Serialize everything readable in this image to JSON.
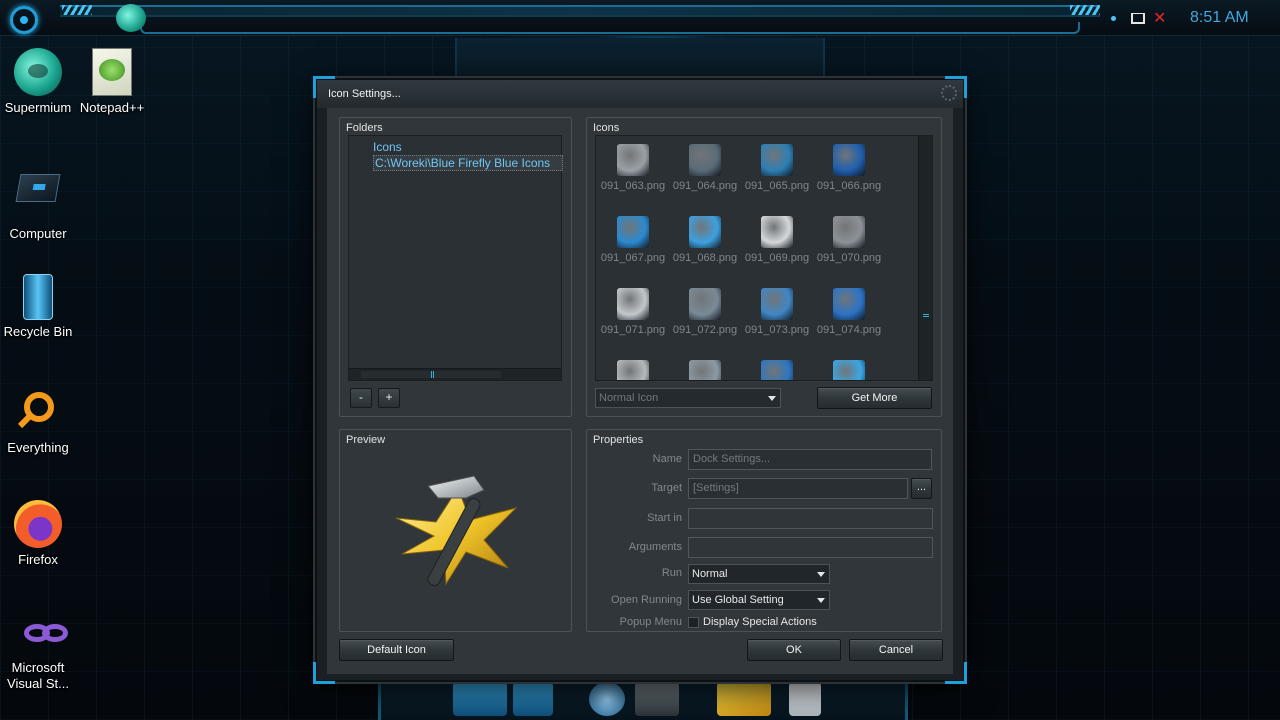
{
  "taskbar": {
    "clock": "8:51 AM"
  },
  "desktop_icons": [
    {
      "label": "Supermium",
      "icon": "supermium-icon"
    },
    {
      "label": "Notepad++",
      "icon": "notepad-plus-plus-icon"
    },
    {
      "label": "Computer",
      "icon": "computer-icon"
    },
    {
      "label": "Recycle Bin",
      "icon": "recycle-bin-icon"
    },
    {
      "label": "Everything",
      "icon": "everything-search-icon"
    },
    {
      "label": "Firefox",
      "icon": "firefox-icon"
    },
    {
      "label": "Microsoft Visual St...",
      "label_line1": "Microsoft",
      "label_line2": "Visual St...",
      "icon": "visual-studio-icon"
    }
  ],
  "dialog": {
    "title": "Icon Settings...",
    "folders": {
      "label": "Folders",
      "root": "Icons",
      "path": "C:\\Woreki\\Blue Firefly Blue Icons",
      "remove_label": "-",
      "add_label": "+"
    },
    "icons": {
      "label": "Icons",
      "items": [
        {
          "file": "091_063.png",
          "color": "#9aa1a6"
        },
        {
          "file": "091_064.png",
          "color": "#5a6b77"
        },
        {
          "file": "091_065.png",
          "color": "#2d7fb6"
        },
        {
          "file": "091_066.png",
          "color": "#1f5fae"
        },
        {
          "file": "091_067.png",
          "color": "#2a8ad0"
        },
        {
          "file": "091_068.png",
          "color": "#3da0e0"
        },
        {
          "file": "091_069.png",
          "color": "#d4d8da"
        },
        {
          "file": "091_070.png",
          "color": "#8c9297"
        },
        {
          "file": "091_071.png",
          "color": "#c3c8cb"
        },
        {
          "file": "091_072.png",
          "color": "#7a8a96"
        },
        {
          "file": "091_073.png",
          "color": "#3f86c4"
        },
        {
          "file": "091_074.png",
          "color": "#2b73c7"
        },
        {
          "file": "",
          "color": "#b5babd"
        },
        {
          "file": "",
          "color": "#8d9aa3"
        },
        {
          "file": "",
          "color": "#2d76c0"
        },
        {
          "file": "",
          "color": "#38a7e6"
        }
      ],
      "state_combo": "Normal Icon",
      "get_more_label": "Get More"
    },
    "preview": {
      "label": "Preview",
      "icon": "hammer-and-star-tool-icon"
    },
    "properties": {
      "label": "Properties",
      "name_label": "Name",
      "name_value": "Dock Settings...",
      "target_label": "Target",
      "target_value": "[Settings]",
      "browse_label": "...",
      "start_in_label": "Start in",
      "start_in_value": "",
      "arguments_label": "Arguments",
      "arguments_value": "",
      "run_label": "Run",
      "run_value": "Normal",
      "open_running_label": "Open Running",
      "open_running_value": "Use Global Setting",
      "popup_menu_label": "Popup Menu",
      "popup_menu_checkbox": "Display Special Actions"
    },
    "buttons": {
      "default_icon": "Default Icon",
      "ok": "OK",
      "cancel": "Cancel"
    }
  }
}
